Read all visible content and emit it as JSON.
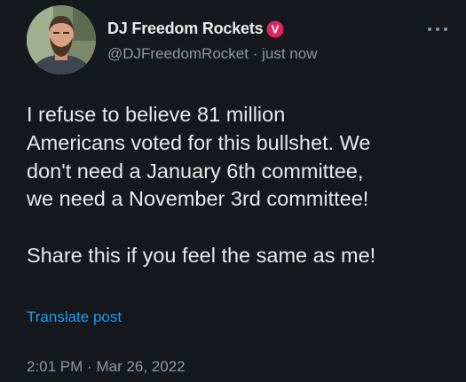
{
  "author": {
    "display_name": "DJ Freedom Rockets",
    "handle": "@DJFreedomRocket",
    "separator": "·",
    "time_ago": "just now",
    "verified_icon": "verified-badge-icon",
    "verified_letter": "V"
  },
  "more_icon": "more-options-icon",
  "tweet": {
    "lines": [
      "I refuse to believe 81 million",
      "Americans voted for this bullshet. We",
      "don't need a January 6th committee,",
      "we need a November 3rd committee!"
    ],
    "second_paragraph": "Share this if you feel the same as me!"
  },
  "translate_label": "Translate post",
  "timestamp": {
    "time": "2:01 PM",
    "separator": "·",
    "date": "Mar 26, 2022"
  },
  "colors": {
    "background": "#15181c",
    "text": "#e7e9ea",
    "muted": "#8b98a5",
    "link": "#1d9bf0",
    "badge": "#e0245e"
  }
}
